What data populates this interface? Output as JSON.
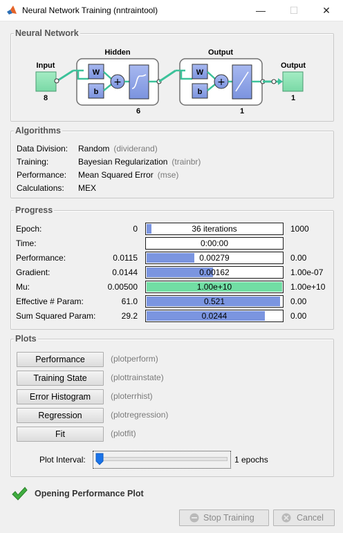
{
  "window": {
    "title": "Neural Network Training (nntraintool)",
    "minimize": "—",
    "maximize": "☐",
    "close": "✕"
  },
  "network": {
    "section_title": "Neural Network",
    "input_label": "Input",
    "input_size": "8",
    "hidden_label": "Hidden",
    "hidden_size": "6",
    "output_layer_label": "Output",
    "output_layer_size": "1",
    "output_label": "Output",
    "output_size": "1",
    "weight_label": "W",
    "bias_label": "b",
    "colors": {
      "io_box": "#8ee4b4",
      "block": "#8fa3e8",
      "connector": "#3cc29a"
    }
  },
  "algorithms": {
    "section_title": "Algorithms",
    "rows": [
      {
        "label": "Data Division:",
        "value": "Random",
        "param": "(dividerand)"
      },
      {
        "label": "Training:",
        "value": "Bayesian Regularization",
        "param": "(trainbr)"
      },
      {
        "label": "Performance:",
        "value": "Mean Squared Error",
        "param": "(mse)"
      },
      {
        "label": "Calculations:",
        "value": "MEX",
        "param": ""
      }
    ]
  },
  "progress": {
    "section_title": "Progress",
    "rows": [
      {
        "label": "Epoch:",
        "start": "0",
        "current": "36 iterations",
        "end": "1000",
        "fill": 0.036,
        "color": "#7b95e0"
      },
      {
        "label": "Time:",
        "start": "",
        "current": "0:00:00",
        "end": "",
        "fill": 0,
        "color": "#7b95e0"
      },
      {
        "label": "Performance:",
        "start": "0.0115",
        "current": "0.00279",
        "end": "0.00",
        "fill": 0.35,
        "color": "#7b95e0"
      },
      {
        "label": "Gradient:",
        "start": "0.0144",
        "current": "0.00162",
        "end": "1.00e-07",
        "fill": 0.49,
        "color": "#7b95e0"
      },
      {
        "label": "Mu:",
        "start": "0.00500",
        "current": "1.00e+10",
        "end": "1.00e+10",
        "fill": 1.0,
        "color": "#71dea4"
      },
      {
        "label": "Effective # Param:",
        "start": "61.0",
        "current": "0.521",
        "end": "0.00",
        "fill": 0.985,
        "color": "#7b95e0"
      },
      {
        "label": "Sum Squared Param:",
        "start": "29.2",
        "current": "0.0244",
        "end": "0.00",
        "fill": 0.87,
        "color": "#7b95e0"
      }
    ]
  },
  "plots": {
    "section_title": "Plots",
    "buttons": [
      {
        "label": "Performance",
        "fn": "(plotperform)"
      },
      {
        "label": "Training State",
        "fn": "(plottrainstate)"
      },
      {
        "label": "Error Histogram",
        "fn": "(ploterrhist)"
      },
      {
        "label": "Regression",
        "fn": "(plotregression)"
      },
      {
        "label": "Fit",
        "fn": "(plotfit)"
      }
    ],
    "interval_label": "Plot Interval:",
    "interval_value": "1 epochs",
    "interval_fraction": 0.0
  },
  "status": {
    "text": "Opening Performance Plot",
    "icon": "checkmark-icon"
  },
  "actions": {
    "stop_label": "Stop Training",
    "cancel_label": "Cancel"
  }
}
